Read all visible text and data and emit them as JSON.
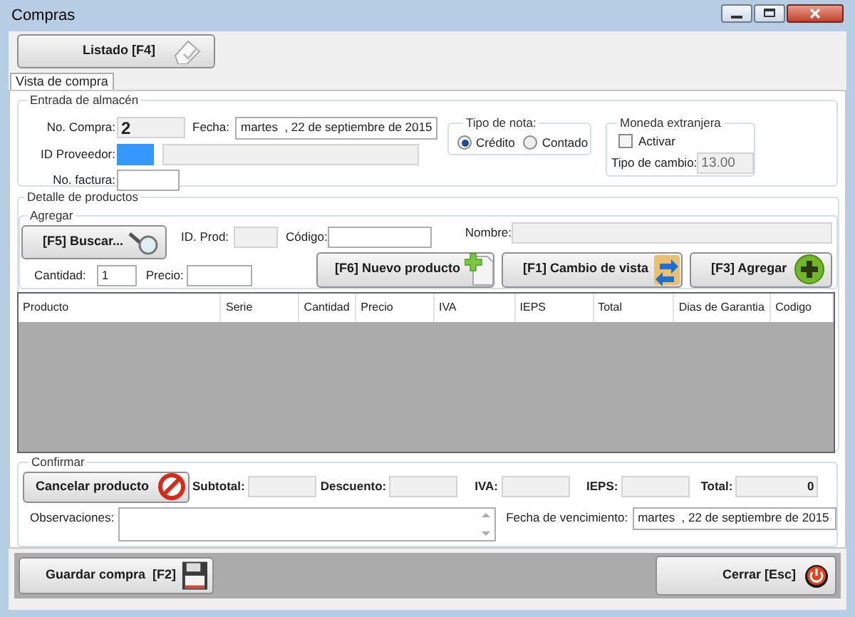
{
  "window": {
    "title": "Compras"
  },
  "toolbar": {
    "listado_button": "Listado [F4]"
  },
  "tabs": [
    {
      "label": "Vista de compra",
      "selected": true
    }
  ],
  "entrada": {
    "title": "Entrada de almacén",
    "no_compra": {
      "label": "No. Compra:",
      "value": "2",
      "disabled": true
    },
    "fecha": {
      "label": "Fecha:",
      "value": "martes  , 22 de septiembre de 2015"
    },
    "id_proveedor": {
      "label": "ID Proveedor:",
      "focused": true
    },
    "proveedor_nombre": {
      "disabled": true
    },
    "no_factura": {
      "label": "No. factura:",
      "disabled": false
    },
    "tipo_nota": {
      "title": "Tipo de nota:",
      "options": [
        {
          "label": "Crédito",
          "selected": true
        },
        {
          "label": "Contado",
          "selected": false
        }
      ]
    },
    "moneda": {
      "title": "Moneda extranjera",
      "activar": {
        "label": "Activar",
        "checked": false
      },
      "tipo_cambio": {
        "label": "Tipo de cambio:",
        "value": "13.00",
        "disabled": true
      }
    }
  },
  "detalle": {
    "title": "Detalle de productos",
    "agregar_title": "Agregar",
    "buscar_button": "[F5] Buscar...",
    "id_prod": {
      "label": "ID. Prod:",
      "disabled": true
    },
    "codigo": {
      "label": "Código:",
      "disabled": false
    },
    "nombre": {
      "label": "Nombre:",
      "disabled": true
    },
    "cantidad": {
      "label": "Cantidad:",
      "value": "1",
      "disabled": false
    },
    "precio": {
      "label": "Precio:",
      "disabled": false
    },
    "buttons": [
      {
        "kind": "new",
        "label": "[F6] Nuevo producto"
      },
      {
        "kind": "view",
        "label": "[F1] Cambio de vista"
      },
      {
        "kind": "add",
        "label": "[F3] Agregar"
      }
    ]
  },
  "table": {
    "columns": [
      "Producto",
      "Serie",
      "Cantidad",
      "Precio",
      "IVA",
      "IEPS",
      "Total",
      "Dias de Garantia",
      "Codigo"
    ]
  },
  "confirmar": {
    "title": "Confirmar",
    "cancel_button": "Cancelar producto",
    "totals": [
      {
        "label": "Subtotal:"
      },
      {
        "label": "Descuento:"
      },
      {
        "label": "IVA:"
      },
      {
        "label": "IEPS:"
      },
      {
        "label": "Total:",
        "value": "0"
      }
    ],
    "observaciones": {
      "label": "Observaciones:"
    },
    "fecha_vencimiento": {
      "label": "Fecha de vencimiento:",
      "value": "martes  , 22 de septiembre de 2015"
    }
  },
  "footer": {
    "guardar_button": "Guardar compra  [F2]",
    "cerrar_button": "Cerrar [Esc]"
  }
}
